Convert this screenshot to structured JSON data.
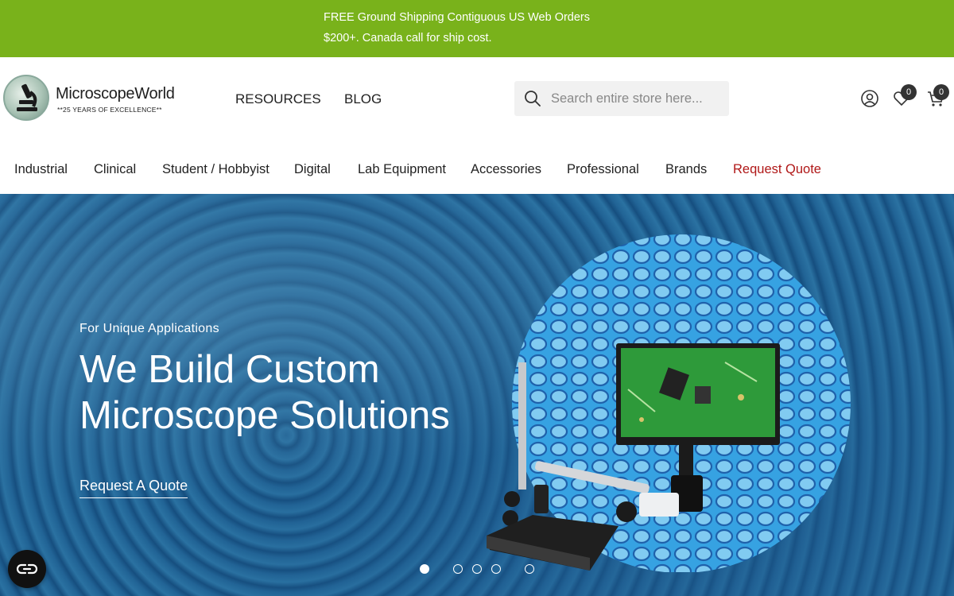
{
  "announcement": {
    "line1": "FREE Ground Shipping Contiguous US Web Orders",
    "line2": "$200+. Canada call for ship cost.",
    "background": "#79b21b"
  },
  "header": {
    "logo": {
      "name": "MicroscopeWorld",
      "tagline": "**25 YEARS OF EXCELLENCE**"
    },
    "links": [
      "RESOURCES",
      "BLOG"
    ],
    "search": {
      "placeholder": "Search entire store here...",
      "value": "",
      "icon": "search-icon"
    },
    "account_icon": "user-icon",
    "wishlist": {
      "icon": "heart-icon",
      "count": "0"
    },
    "cart": {
      "icon": "cart-icon",
      "count": "0"
    }
  },
  "categories": [
    "Industrial",
    "Clinical",
    "Student / Hobbyist",
    "Digital",
    "Lab Equipment",
    "Accessories",
    "Professional",
    "Brands",
    "Request Quote"
  ],
  "hero": {
    "subtitle": "For Unique Applications",
    "title_line1": "We Build Custom",
    "title_line2": "Microscope Solutions",
    "cta": "Request A Quote",
    "slide_count": 5,
    "active_slide": 1
  },
  "accessibility_button": {
    "icon": "accessibility-icon"
  },
  "colors": {
    "accent": "#79b21b",
    "quote_link": "#b01818",
    "badge": "#333333"
  }
}
